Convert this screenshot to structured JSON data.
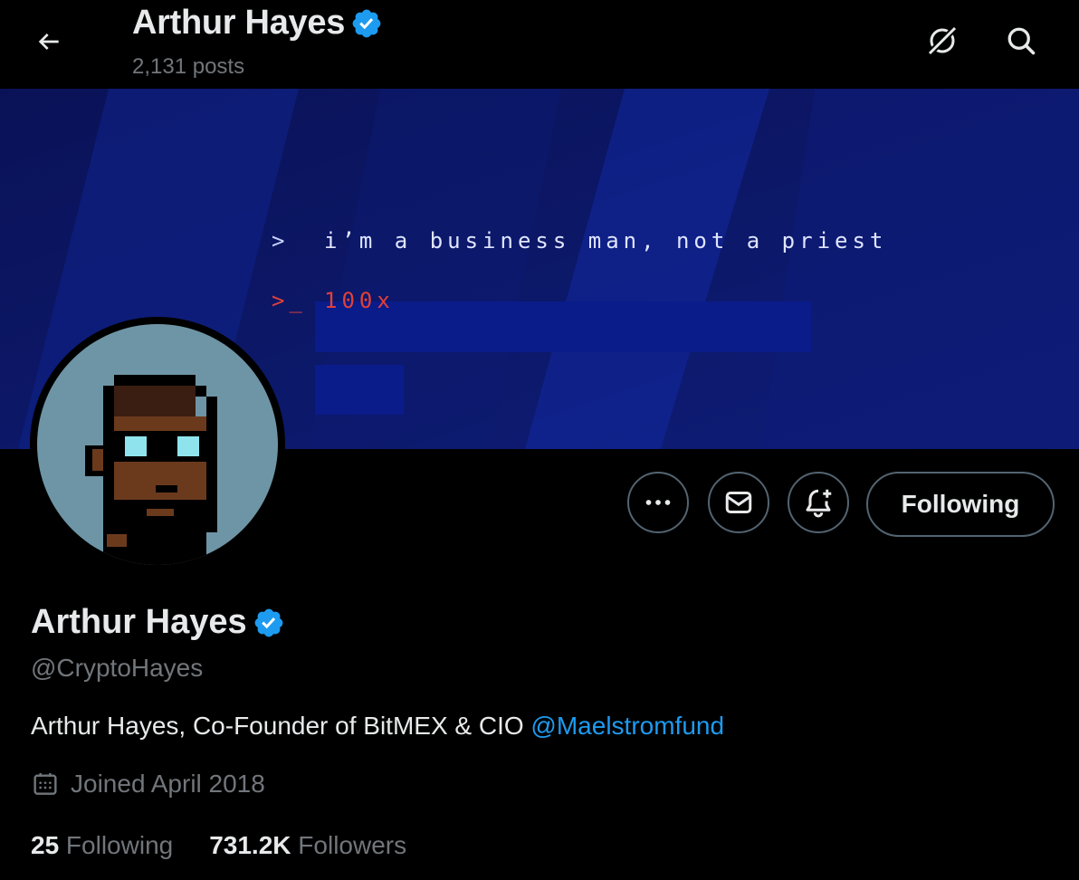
{
  "header": {
    "title": "Arthur Hayes",
    "posts_count": "2,131 posts",
    "icons": [
      "back-arrow-icon",
      "grok-icon",
      "search-icon"
    ]
  },
  "banner": {
    "line1_prompt": ">",
    "line1_text": "i’m a business man, not a priest",
    "line2_prompt": ">_",
    "line2_text": "100x",
    "colors": {
      "background": "#0b1660",
      "highlight": "#0a1b8a",
      "red_text": "#e0403a"
    }
  },
  "actions": {
    "more_icon": "more-icon",
    "message_icon": "message-icon",
    "notify_icon": "notification-bell-icon",
    "follow_label": "Following"
  },
  "profile": {
    "name": "Arthur Hayes",
    "handle": "@CryptoHayes",
    "bio_text": "Arthur Hayes, Co-Founder of BitMEX & CIO ",
    "bio_link": "@Maelstromfund",
    "joined": "Joined April 2018",
    "following_count": "25",
    "following_label": " Following",
    "followers_count": "731.2K",
    "followers_label": " Followers"
  },
  "colors": {
    "accent": "#1d9bf0",
    "muted": "#71767b",
    "text": "#e7e9ea"
  }
}
